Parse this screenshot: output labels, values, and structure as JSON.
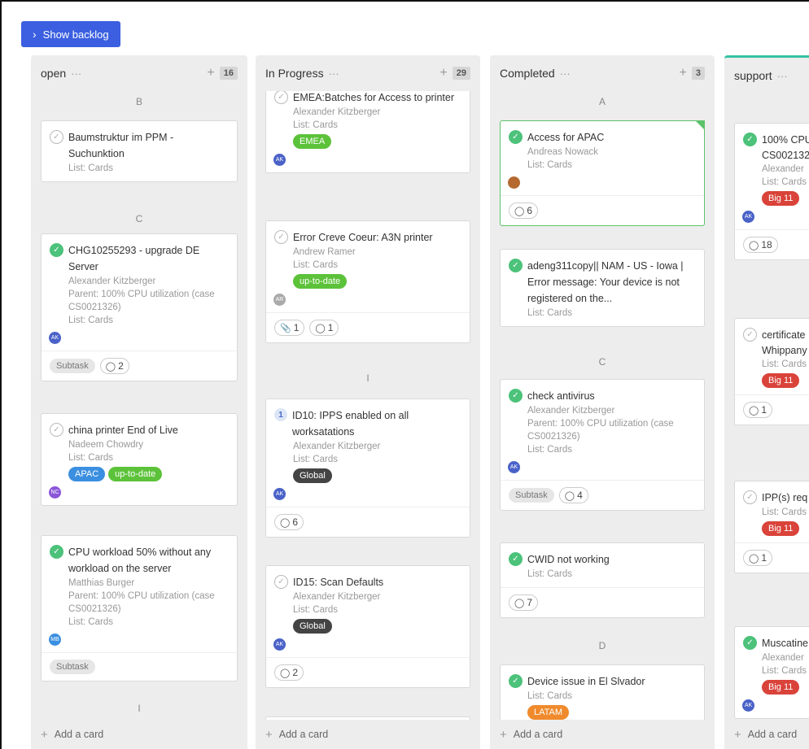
{
  "toolbar": {
    "backlog_label": "Show backlog"
  },
  "columns": {
    "open": {
      "title": "open",
      "count": "16",
      "add_label": "Add a card",
      "groups": [
        "B",
        "C",
        "I"
      ],
      "cards": [
        {
          "title": "Baumstruktur im PPM - Suchunktion",
          "list": "List: Cards"
        },
        {
          "title": "CHG10255293 - upgrade DE Server",
          "person": "Alexander Kitzberger",
          "parent": "Parent: 100% CPU utilization (case CS0021326)",
          "list": "List: Cards",
          "avatar": "AK",
          "subtask": "Subtask",
          "comments": "2"
        },
        {
          "title": "china printer End of Live",
          "person": "Nadeem Chowdry",
          "list": "List: Cards",
          "tags": [
            "APAC",
            "up-to-date"
          ],
          "avatar": "NC"
        },
        {
          "title": "CPU workload 50% without any workload on the server",
          "person": "Matthias Burger",
          "parent": "Parent: 100% CPU utilization (case CS0021326)",
          "list": "List: Cards",
          "avatar": "MB",
          "subtask": "Subtask"
        }
      ]
    },
    "in_progress": {
      "title": "In Progress",
      "count": "29",
      "add_label": "Add a card",
      "groups": [
        "I"
      ],
      "cards": [
        {
          "title": "EMEA:Batches for Access to printer",
          "person": "Alexander Kitzberger",
          "list": "List: Cards",
          "tags": [
            "EMEA"
          ],
          "avatar": "AK"
        },
        {
          "title": "Error Creve Coeur: A3N printer",
          "person": "Andrew Ramer",
          "list": "List: Cards",
          "tags": [
            "up-to-date"
          ],
          "avatar": "AR",
          "attachments": "1",
          "comments": "1"
        },
        {
          "num": "1",
          "title": "ID10: IPPS enabled on all worksatations",
          "person": "Alexander Kitzberger",
          "list": "List: Cards",
          "tags": [
            "Global"
          ],
          "avatar": "AK",
          "comments": "6"
        },
        {
          "title": "ID15: Scan Defaults",
          "person": "Alexander Kitzberger",
          "list": "List: Cards",
          "tags": [
            "Global"
          ],
          "avatar": "AK",
          "comments": "2"
        }
      ]
    },
    "completed": {
      "title": "Completed",
      "count": "3",
      "add_label": "Add a card",
      "groups": [
        "A",
        "C",
        "D"
      ],
      "cards": [
        {
          "title": "Access for APAC",
          "person": "Andreas Nowack",
          "list": "List: Cards",
          "comments": "6"
        },
        {
          "title": "adeng311copy|| NAM - US - Iowa | Error message: Your device is not registered on the...",
          "list": "List: Cards"
        },
        {
          "title": "check antivirus",
          "person": "Alexander Kitzberger",
          "parent": "Parent: 100% CPU utilization (case CS0021326)",
          "list": "List: Cards",
          "avatar": "AK",
          "subtask": "Subtask",
          "comments": "4"
        },
        {
          "title": "CWID not working",
          "list": "List: Cards",
          "comments": "7"
        },
        {
          "title": "Device issue in El Slvador",
          "list": "List: Cards",
          "tags": [
            "LATAM"
          ]
        }
      ]
    },
    "support": {
      "title": "support",
      "add_label": "Add a card",
      "cards": [
        {
          "title": "100% CPU",
          "title2": "CS002132",
          "person": "Alexander",
          "list": "List: Cards",
          "tags": [
            "Big 11"
          ],
          "avatar": "AK",
          "comments": "18"
        },
        {
          "title": "certificate",
          "title2": "Whippany",
          "list": "List: Cards",
          "tags": [
            "Big 11"
          ],
          "comments": "1"
        },
        {
          "title": "IPP(s) req",
          "list": "List: Cards",
          "tags": [
            "Big 11"
          ],
          "comments": "1"
        },
        {
          "title": "Muscatine",
          "person": "Alexander",
          "list": "List: Cards",
          "tags": [
            "Big 11"
          ],
          "avatar": "AK"
        }
      ]
    }
  },
  "colors": {
    "primary": "#3b5fe0",
    "done": "#4cc27a",
    "support_accent": "#35c1a5",
    "tag_green": "#5cc23a",
    "tag_blue": "#3b8fe0",
    "tag_dark": "#444444",
    "tag_red": "#d9433a",
    "tag_orange": "#f08a2c"
  }
}
